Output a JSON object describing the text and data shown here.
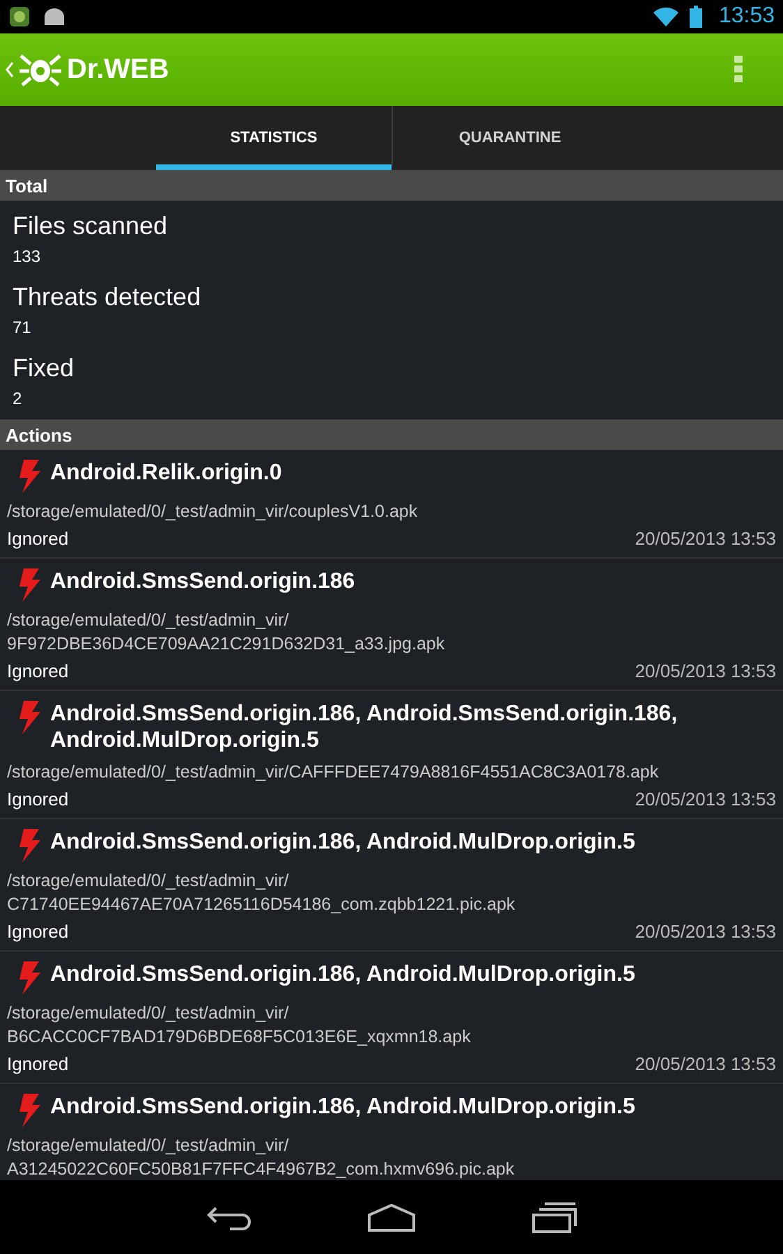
{
  "status_bar": {
    "time": "13:53"
  },
  "app_bar": {
    "title": "Dr.WEB"
  },
  "tabs": [
    {
      "label": "STATISTICS",
      "selected": true
    },
    {
      "label": "QUARANTINE",
      "selected": false
    }
  ],
  "total": {
    "header": "Total",
    "stats": [
      {
        "label": "Files scanned",
        "value": "133"
      },
      {
        "label": "Threats detected",
        "value": "71"
      },
      {
        "label": "Fixed",
        "value": "2"
      }
    ]
  },
  "actions": {
    "header": "Actions",
    "items": [
      {
        "threat": "Android.Relik.origin.0",
        "path": [
          "/storage/emulated/0/_test/admin_vir/couplesV1.0.apk"
        ],
        "status": "Ignored",
        "date": "20/05/2013 13:53"
      },
      {
        "threat": "Android.SmsSend.origin.186",
        "path": [
          "/storage/emulated/0/_test/admin_vir/",
          "9F972DBE36D4CE709AA21C291D632D31_a33.jpg.apk"
        ],
        "status": "Ignored",
        "date": "20/05/2013 13:53"
      },
      {
        "threat": "Android.SmsSend.origin.186, Android.SmsSend.origin.186, Android.MulDrop.origin.5",
        "path": [
          "/storage/emulated/0/_test/admin_vir/CAFFFDEE7479A8816F4551AC8C3A0178.apk"
        ],
        "status": "Ignored",
        "date": "20/05/2013 13:53"
      },
      {
        "threat": "Android.SmsSend.origin.186, Android.MulDrop.origin.5",
        "path": [
          "/storage/emulated/0/_test/admin_vir/",
          "C71740EE94467AE70A71265116D54186_com.zqbb1221.pic.apk"
        ],
        "status": "Ignored",
        "date": "20/05/2013 13:53"
      },
      {
        "threat": "Android.SmsSend.origin.186, Android.MulDrop.origin.5",
        "path": [
          "/storage/emulated/0/_test/admin_vir/",
          "B6CACC0CF7BAD179D6BDE68F5C013E6E_xqxmn18.apk"
        ],
        "status": "Ignored",
        "date": "20/05/2013 13:53"
      },
      {
        "threat": "Android.SmsSend.origin.186, Android.MulDrop.origin.5",
        "path": [
          "/storage/emulated/0/_test/admin_vir/",
          "A31245022C60FC50B81F7FFC4F4967B2_com.hxmv696.pic.apk"
        ]
      }
    ]
  }
}
